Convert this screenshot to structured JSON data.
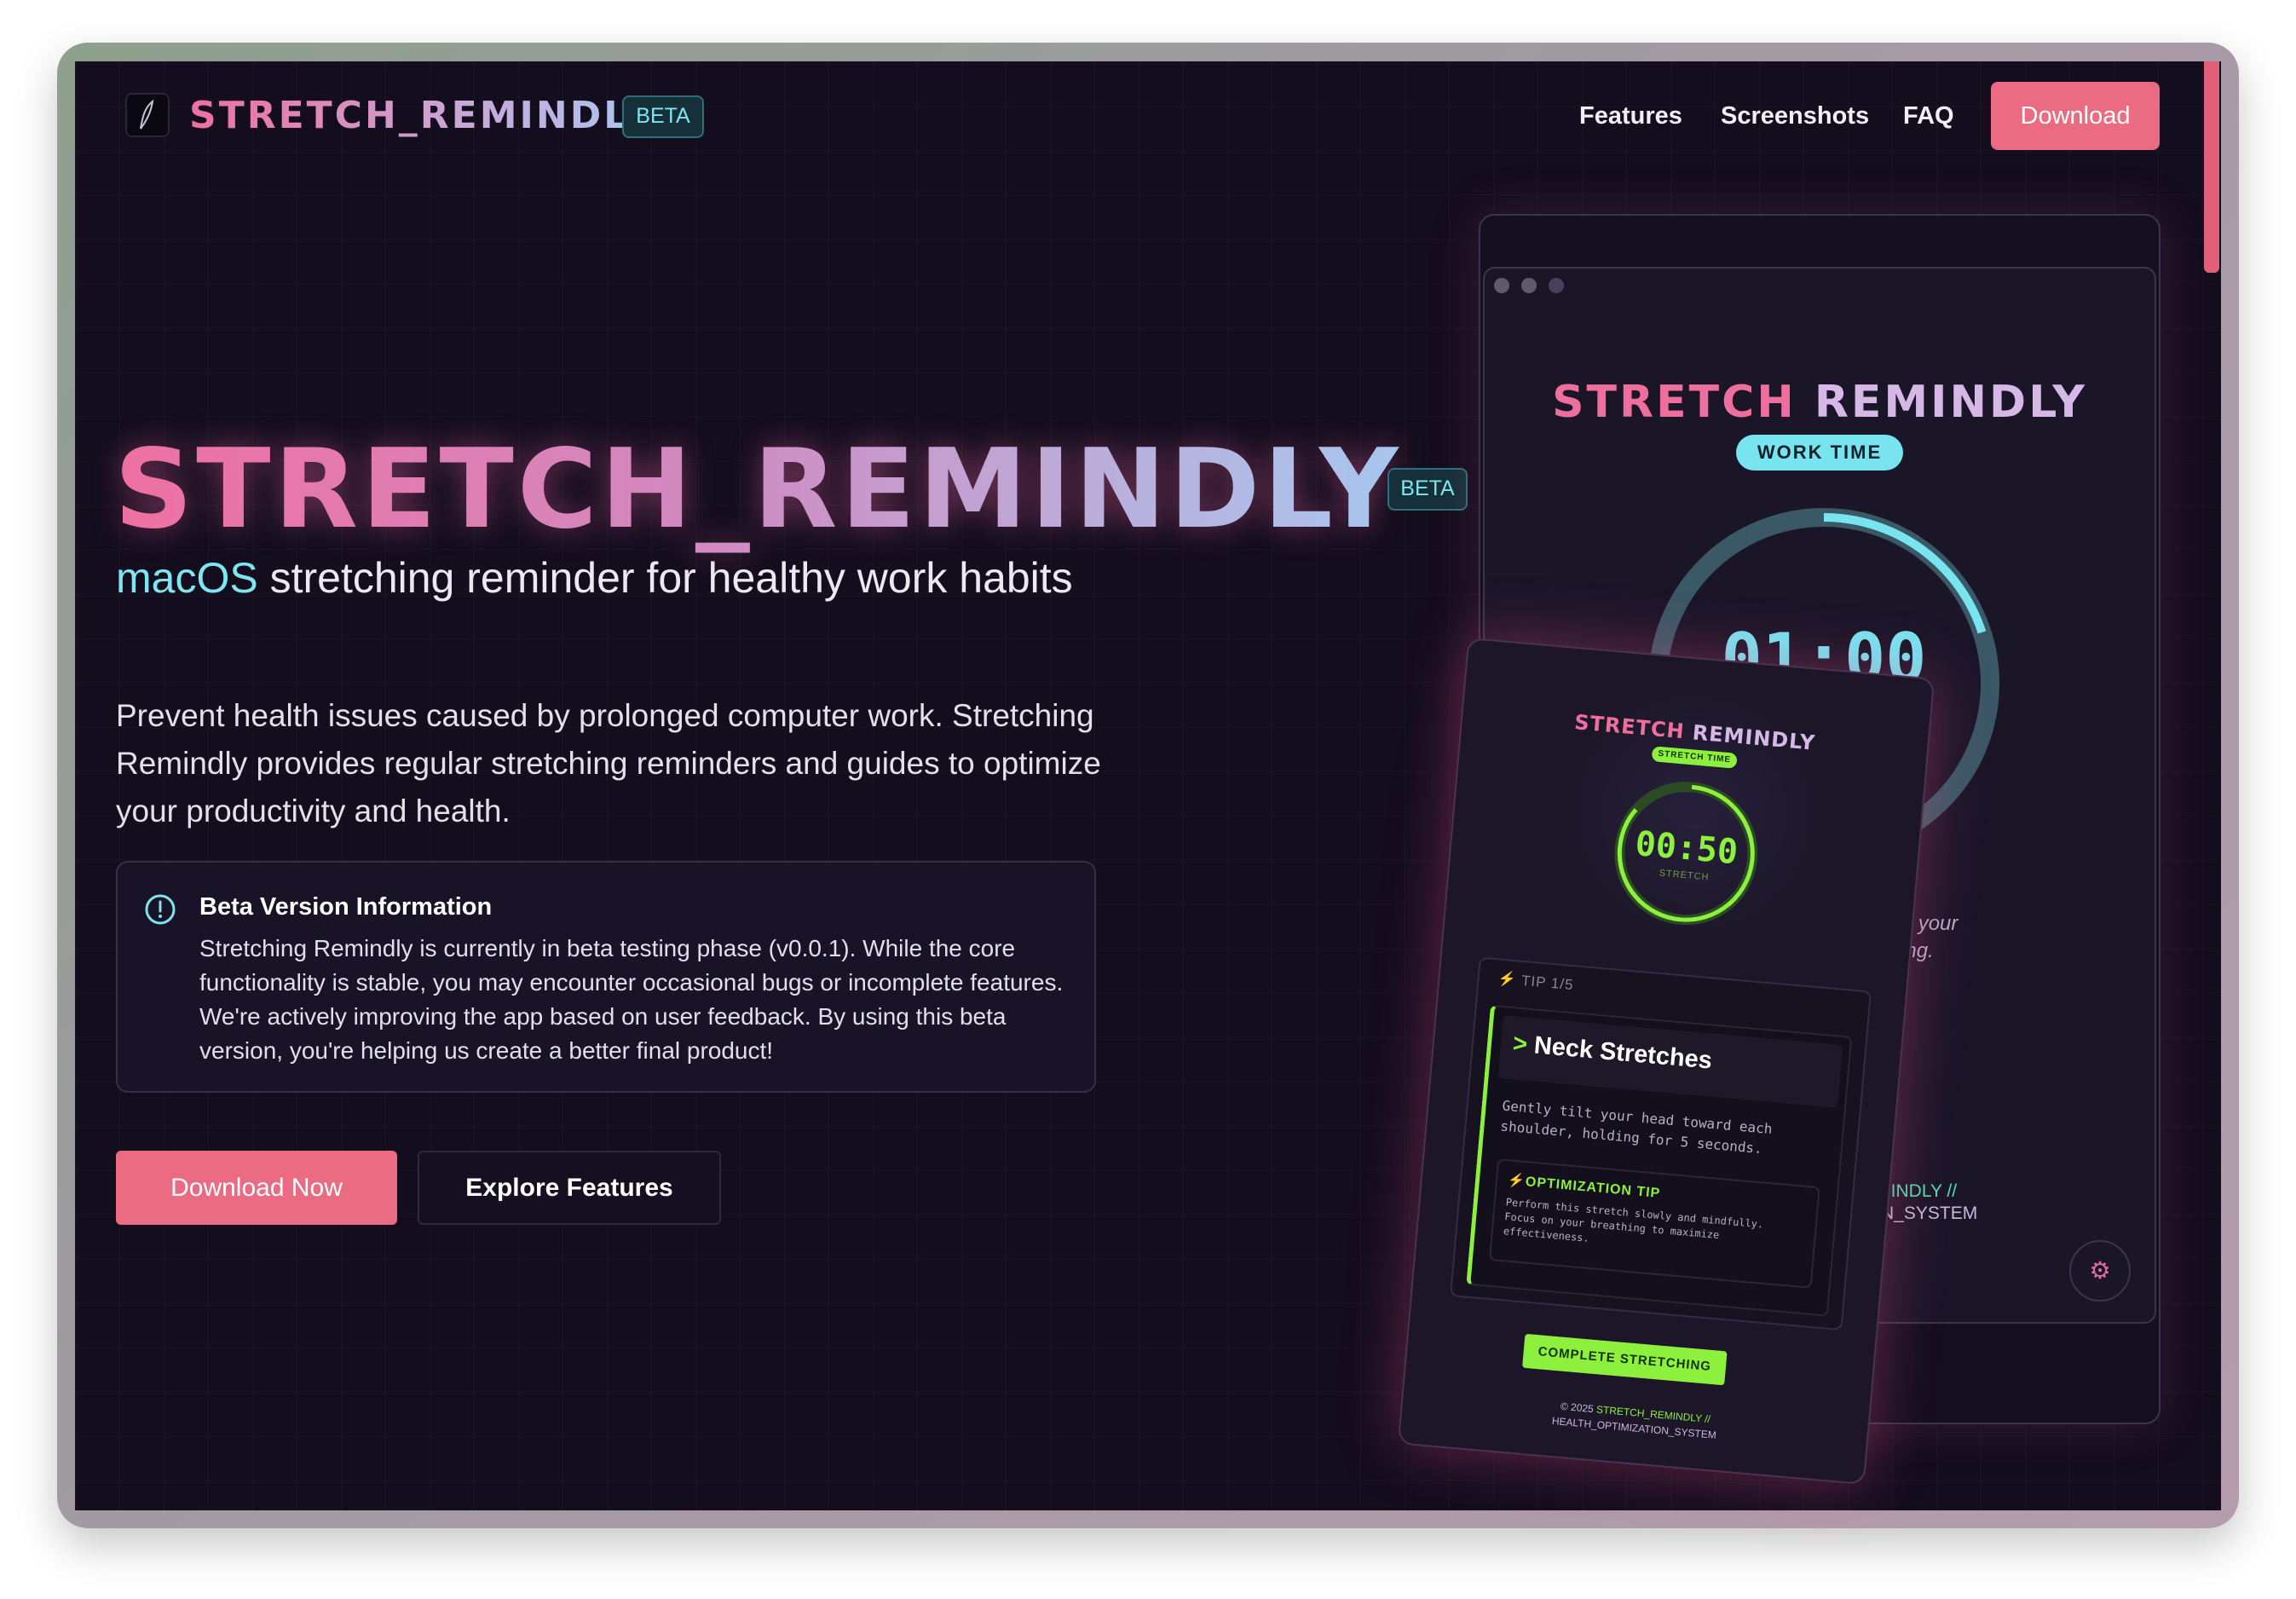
{
  "colors": {
    "accent_pink": "#ea6b82",
    "accent_cyan": "#7ee6f0",
    "accent_green": "#8cf03c",
    "background": "#130d1d"
  },
  "nav": {
    "brand": "STRETCH_REMINDLY",
    "badge": "BETA",
    "links": [
      "Features",
      "Screenshots",
      "FAQ"
    ],
    "download": "Download"
  },
  "hero": {
    "title": "STRETCH_REMINDLY",
    "badge": "BETA",
    "subtitle_accent": "macOS",
    "subtitle_rest": " stretching reminder for healthy work habits",
    "description": "Prevent health issues caused by prolonged computer work. Stretching Remindly provides regular stretching reminders and guides to optimize your productivity and health."
  },
  "notice": {
    "icon": "info-icon",
    "title": "Beta Version Information",
    "body": "Stretching Remindly is currently in beta testing phase (v0.0.1). While the core functionality is stable, you may encounter occasional bugs or incomplete features. We're actively improving the app based on user feedback. By using this beta version, you're helping us create a better final product!"
  },
  "cta": {
    "primary": "Download Now",
    "secondary": "Explore Features"
  },
  "mock_back": {
    "title_a": "STRETCH ",
    "title_b": "REMINDLY",
    "status": "WORK TIME",
    "timer": "01:00",
    "progress": 0.2,
    "partial_text_1": "nize your",
    "partial_text_1b": "incoming.",
    "partial_footer_1": "REMINDLY //",
    "partial_footer_2": "TION_SYSTEM",
    "gear_icon": "gear-icon"
  },
  "mock_front": {
    "title_a": "STRETCH ",
    "title_b": "REMINDLY",
    "status": "STRETCH TIME",
    "timer": "00:50",
    "timer_label": "STRETCH",
    "progress": 0.85,
    "tip_label": "TIP 1/5",
    "tip_heading": "Neck Stretches",
    "tip_description": "Gently tilt your head toward each shoulder, holding for 5 seconds.",
    "optimization_title": "OPTIMIZATION TIP",
    "optimization_body": "Perform this stretch slowly and mindfully. Focus on your breathing to maximize effectiveness.",
    "complete_button": "COMPLETE STRETCHING",
    "footer_prefix": "© 2025 ",
    "footer_brand": "STRETCH_REMINDLY //",
    "footer_line2": "HEALTH_OPTIMIZATION_SYSTEM"
  }
}
